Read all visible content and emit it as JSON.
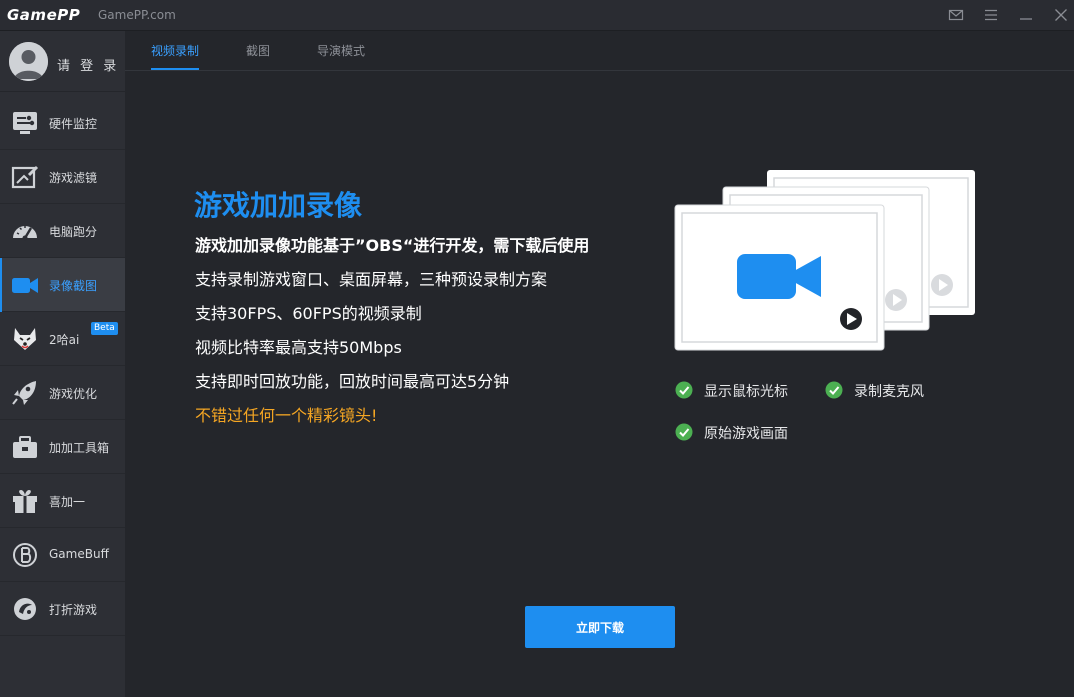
{
  "titlebar": {
    "logo": "GamePP",
    "site": "GamePP.com",
    "buttons": [
      "mail-icon",
      "menu-icon",
      "minimize-icon",
      "close-icon"
    ]
  },
  "sidebar": {
    "login_label": "请 登 录",
    "items": [
      {
        "label": "硬件监控",
        "icon": "hardware-monitor-icon"
      },
      {
        "label": "游戏滤镜",
        "icon": "game-filter-icon"
      },
      {
        "label": "电脑跑分",
        "icon": "benchmark-gauge-icon"
      },
      {
        "label": "录像截图",
        "icon": "video-camera-icon",
        "active": true
      },
      {
        "label": "2哈ai",
        "icon": "husky-icon",
        "badge": "Beta"
      },
      {
        "label": "游戏优化",
        "icon": "rocket-icon"
      },
      {
        "label": "加加工具箱",
        "icon": "toolbox-icon"
      },
      {
        "label": "喜加一",
        "icon": "gift-icon"
      },
      {
        "label": "GameBuff",
        "icon": "gamebuff-icon"
      },
      {
        "label": "打折游戏",
        "icon": "discount-game-icon"
      }
    ]
  },
  "tabs": [
    {
      "label": "视频录制",
      "active": true
    },
    {
      "label": "截图"
    },
    {
      "label": "导演模式"
    }
  ],
  "main": {
    "headline": "游戏加加录像",
    "lines": [
      "游戏加加录像功能基于”OBS“进行开发，需下载后使用",
      "支持录制游戏窗口、桌面屏幕，三种预设录制方案",
      "支持30FPS、60FPS的视频录制",
      "视频比特率最高支持50Mbps",
      "支持即时回放功能，回放时间最高可达5分钟",
      "不错过任何一个精彩镜头!"
    ],
    "features": [
      "显示鼠标光标",
      "录制麦克风",
      "原始游戏画面"
    ],
    "download_label": "立即下载"
  },
  "colors": {
    "accent": "#1e8ef0",
    "highlight": "#f5a623",
    "check": "#4cb052",
    "background": "#24262b",
    "sidebar": "#2d2f35"
  }
}
